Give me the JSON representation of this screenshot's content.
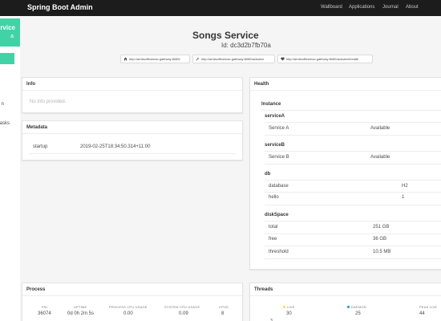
{
  "navbar": {
    "brand": "Spring Boot Admin",
    "links": [
      "Wallboard",
      "Applications",
      "Journal",
      "About"
    ]
  },
  "sidebar": {
    "service_name": "Service",
    "service_sub": "a",
    "items": [
      "n",
      "asks"
    ]
  },
  "header": {
    "title": "Songs Service",
    "id": "Id: dc3d2b7fb70a",
    "urls": [
      "http://amitsofficemac.gateway:8085/",
      "http://amitsofficemac.gateway:8085/actuator",
      "http://amitsofficemac.gateway:8085/actuator/health"
    ]
  },
  "info": {
    "title": "Info",
    "empty_text": "No info provided."
  },
  "metadata": {
    "title": "Metadata",
    "rows": [
      {
        "key": "startup",
        "value": "2019-02-25T18:34:50.314+11:00"
      }
    ]
  },
  "health": {
    "title": "Health",
    "instance_label": "Instance",
    "groups": [
      {
        "name": "serviceA",
        "rows": [
          {
            "key": "Service A",
            "value": "Available"
          }
        ]
      },
      {
        "name": "serviceB",
        "rows": [
          {
            "key": "Service B",
            "value": "Available"
          }
        ]
      },
      {
        "name": "db",
        "rows": [
          {
            "key": "database",
            "value": "H2"
          },
          {
            "key": "hello",
            "value": "1"
          }
        ]
      },
      {
        "name": "diskSpace",
        "rows": [
          {
            "key": "total",
            "value": "251 GB"
          },
          {
            "key": "free",
            "value": "36 GB"
          },
          {
            "key": "threshold",
            "value": "10.5 MB"
          }
        ]
      }
    ]
  },
  "process": {
    "title": "Process",
    "stats": [
      {
        "label": "PID",
        "value": "36074"
      },
      {
        "label": "UPTIME",
        "value": "0d 0h 2m 5s"
      },
      {
        "label": "PROCESS CPU USAGE",
        "value": "0.00"
      },
      {
        "label": "SYSTEM CPU USAGE",
        "value": "0.09"
      },
      {
        "label": "CPUS",
        "value": "8"
      }
    ]
  },
  "threads": {
    "title": "Threads",
    "stats": [
      {
        "label": "LIVE",
        "value": "30"
      },
      {
        "label": "DAEMON",
        "value": "25"
      },
      {
        "label": "PEAK LIVE",
        "value": "44"
      }
    ],
    "axis_tick": "3"
  },
  "colors": {
    "navbar": "#1c1c1c",
    "accent": "#41d3a6",
    "live_dot": "#ffdd57",
    "daemon_dot": "#209cee"
  },
  "icons": [
    "home-icon",
    "wrench-icon",
    "heart-icon"
  ]
}
